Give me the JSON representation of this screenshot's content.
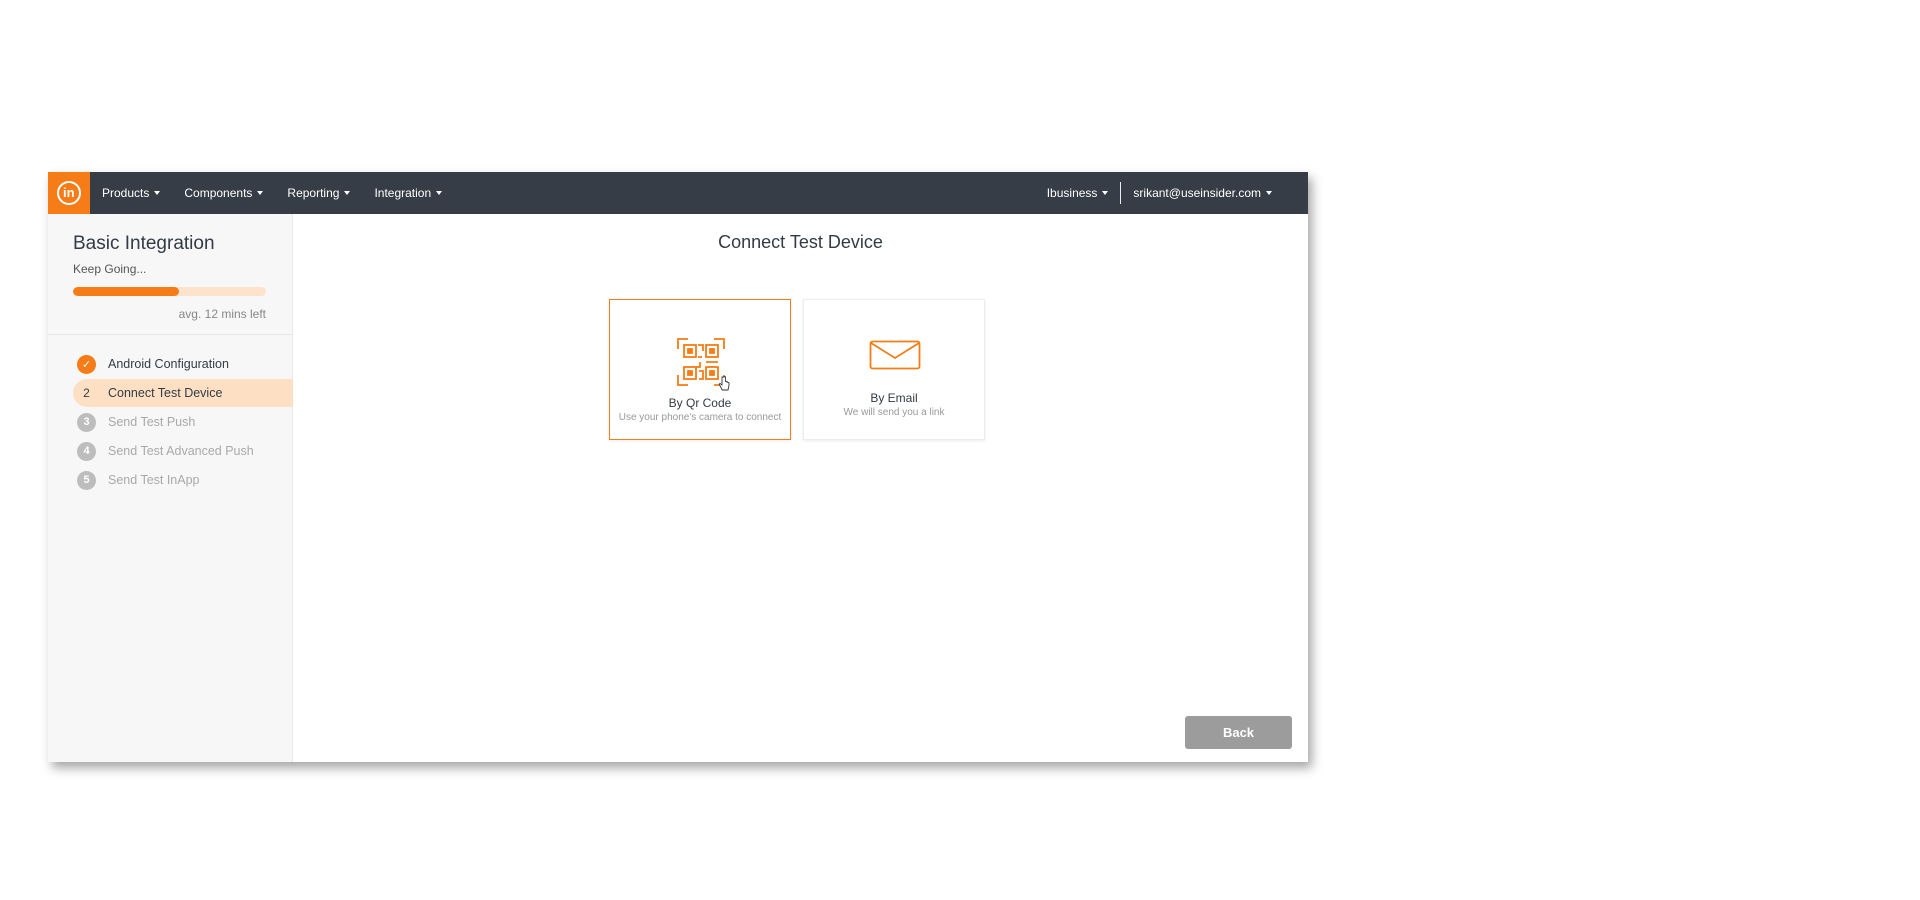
{
  "nav": {
    "logo_text": "in",
    "menu": [
      {
        "label": "Products"
      },
      {
        "label": "Components"
      },
      {
        "label": "Reporting"
      },
      {
        "label": "Integration"
      }
    ],
    "account": "Ibusiness",
    "user": "srikant@useinsider.com"
  },
  "sidebar": {
    "title": "Basic Integration",
    "subtitle": "Keep Going...",
    "progress_percent": 55,
    "time_left": "avg. 12 mins left",
    "steps": [
      {
        "number": "✓",
        "label": "Android Configuration",
        "state": "done"
      },
      {
        "number": "2",
        "label": "Connect Test Device",
        "state": "active"
      },
      {
        "number": "3",
        "label": "Send Test Push",
        "state": "pending"
      },
      {
        "number": "4",
        "label": "Send Test Advanced Push",
        "state": "pending"
      },
      {
        "number": "5",
        "label": "Send Test InApp",
        "state": "pending"
      }
    ]
  },
  "main": {
    "title": "Connect Test Device",
    "options": [
      {
        "label": "By Qr Code",
        "description": "Use your phone's camera to connect",
        "icon": "qr-code-icon",
        "selected": true
      },
      {
        "label": "By Email",
        "description": "We will send you a link",
        "icon": "envelope-icon",
        "selected": false
      }
    ],
    "back_label": "Back"
  },
  "colors": {
    "accent": "#f57c16",
    "nav_bg": "#363d47",
    "active_step_bg": "#fde0c4",
    "button_bg": "#9c9c9c"
  }
}
